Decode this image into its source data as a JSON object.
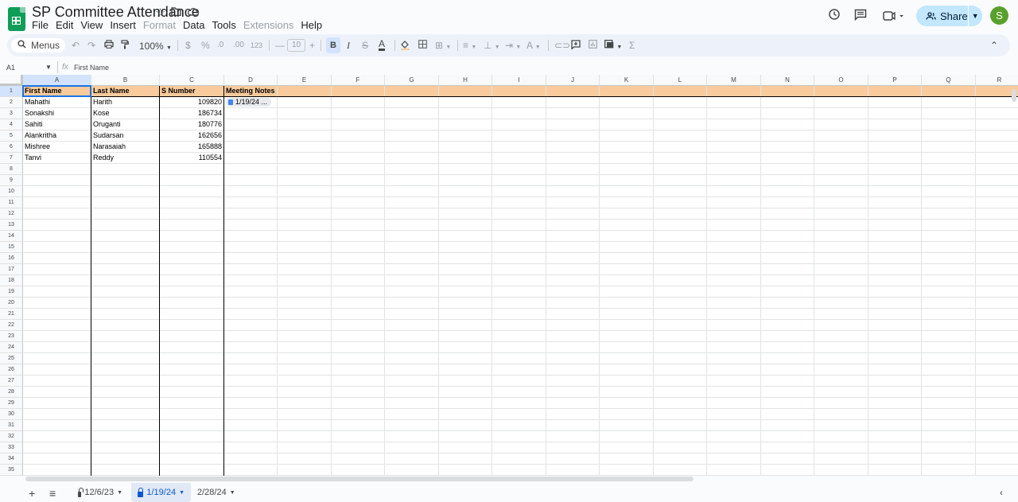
{
  "app": {
    "title": "SP Committee Attendance",
    "menu": [
      {
        "label": "File",
        "enabled": true
      },
      {
        "label": "Edit",
        "enabled": true
      },
      {
        "label": "View",
        "enabled": true
      },
      {
        "label": "Insert",
        "enabled": true
      },
      {
        "label": "Format",
        "enabled": false
      },
      {
        "label": "Data",
        "enabled": true
      },
      {
        "label": "Tools",
        "enabled": true
      },
      {
        "label": "Extensions",
        "enabled": false
      },
      {
        "label": "Help",
        "enabled": true
      }
    ],
    "share_label": "Share",
    "avatar_initial": "S"
  },
  "toolbar": {
    "menus_label": "Menus",
    "zoom": "100%",
    "currency": "$",
    "percent": "%",
    "dec_decrease": ".0",
    "dec_increase": ".00",
    "number_format": "123",
    "font_size": "10",
    "bold": "B",
    "italic": "I",
    "sum": "Σ"
  },
  "formula_bar": {
    "name_box": "A1",
    "fx": "fx",
    "content": "First Name"
  },
  "columns": [
    "A",
    "B",
    "C",
    "D",
    "E",
    "F",
    "G",
    "H",
    "I",
    "J",
    "K",
    "L",
    "M",
    "N",
    "O",
    "P",
    "Q",
    "R"
  ],
  "rows": {
    "count": 35
  },
  "sheet": {
    "header": [
      "First Name",
      "Last Name",
      "S Number",
      "Meeting Notes"
    ],
    "data": [
      [
        "Mahathi",
        "Harith",
        "109820",
        "1/19/24 ..."
      ],
      [
        "Sonakshi",
        "Kose",
        "186734",
        ""
      ],
      [
        "Sahiti",
        "Oruganti",
        "180776",
        ""
      ],
      [
        "Alankritha",
        "Sudarsan",
        "162656",
        ""
      ],
      [
        "Mishree",
        "Narasaiah",
        "165888",
        ""
      ],
      [
        "Tanvi",
        "Reddy",
        "110554",
        ""
      ]
    ],
    "header_fill": "#f9cb9c",
    "selected_cell": "A1"
  },
  "tabs": [
    {
      "label": "12/6/23",
      "locked": true,
      "active": false
    },
    {
      "label": "1/19/24",
      "locked": true,
      "active": true
    },
    {
      "label": "2/28/24",
      "locked": false,
      "active": false
    }
  ]
}
